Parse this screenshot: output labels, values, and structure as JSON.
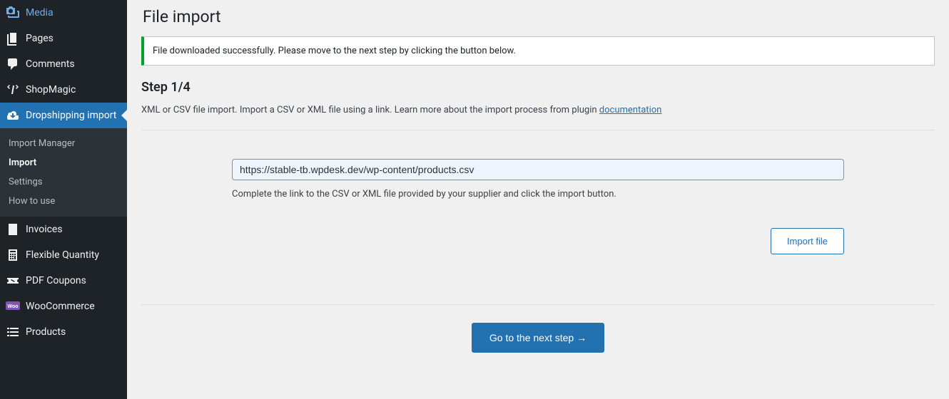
{
  "sidebar": {
    "items": [
      {
        "label": "Media"
      },
      {
        "label": "Pages"
      },
      {
        "label": "Comments"
      },
      {
        "label": "ShopMagic"
      },
      {
        "label": "Dropshipping import"
      },
      {
        "label": "Invoices"
      },
      {
        "label": "Flexible Quantity"
      },
      {
        "label": "PDF Coupons"
      },
      {
        "label": "WooCommerce"
      },
      {
        "label": "Products"
      }
    ],
    "submenu": [
      {
        "label": "Import Manager"
      },
      {
        "label": "Import"
      },
      {
        "label": "Settings"
      },
      {
        "label": "How to use"
      }
    ]
  },
  "main": {
    "title": "File import",
    "notice": "File downloaded successfully. Please move to the next step by clicking the button below.",
    "step": "Step 1/4",
    "description_prefix": "XML or CSV file import. Import a CSV or XML file using a link. Learn more about the import process from plugin ",
    "description_link": "documentation",
    "url_value": "https://stable-tb.wpdesk.dev/wp-content/products.csv",
    "help_text": "Complete the link to the CSV or XML file provided by your supplier and click the import button.",
    "import_button": "Import file",
    "next_button": "Go to the next step →"
  }
}
